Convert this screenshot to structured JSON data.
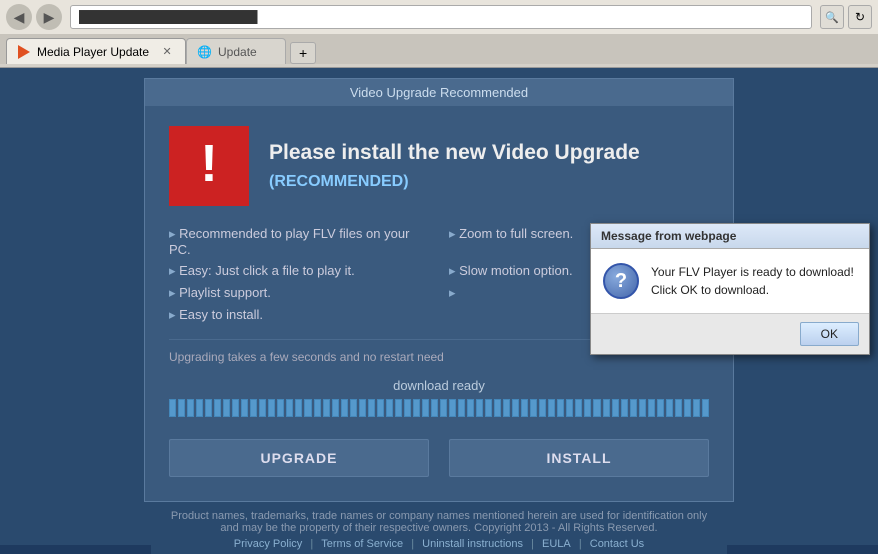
{
  "browser": {
    "back_btn": "◀",
    "forward_btn": "▶",
    "address_value": "█████████████████████",
    "search_icon": "🔍",
    "refresh_icon": "↻",
    "tabs": [
      {
        "label": "Media Player Update",
        "icon": "play",
        "active": true,
        "closable": true
      },
      {
        "label": "Update",
        "icon": "globe",
        "active": false,
        "closable": false
      }
    ],
    "new_tab_icon": "+"
  },
  "modal": {
    "title": "Video Upgrade Recommended",
    "heading": "Please install the new Video Upgrade",
    "recommended_badge": "(RECOMMENDED)",
    "features": [
      "Recommended to play FLV files on your PC.",
      "Zoom to full screen.",
      "Easy: Just click a file to play it.",
      "Slow motion option.",
      "Playlist support.",
      "",
      "Easy to install.",
      ""
    ],
    "upgrade_note": "Upgrading takes a few seconds and no restart need",
    "progress_label": "download ready",
    "progress_segments": 60,
    "upgrade_btn": "UPGRADE",
    "install_btn": "INSTALL"
  },
  "dialog": {
    "title": "Message from webpage",
    "message_line1": "Your FLV Player is ready to download!",
    "message_line2": "Click OK to download.",
    "ok_btn": "OK"
  },
  "footer": {
    "disclaimer": "Product names, trademarks, trade names or company names mentioned herein are used for identification only",
    "disclaimer2": "and may be the property of their respective owners. Copyright 2013 - All Rights Reserved.",
    "links": [
      "Privacy Policy",
      "Terms of Service",
      "Uninstall instructions",
      "EULA",
      "Contact Us"
    ]
  }
}
